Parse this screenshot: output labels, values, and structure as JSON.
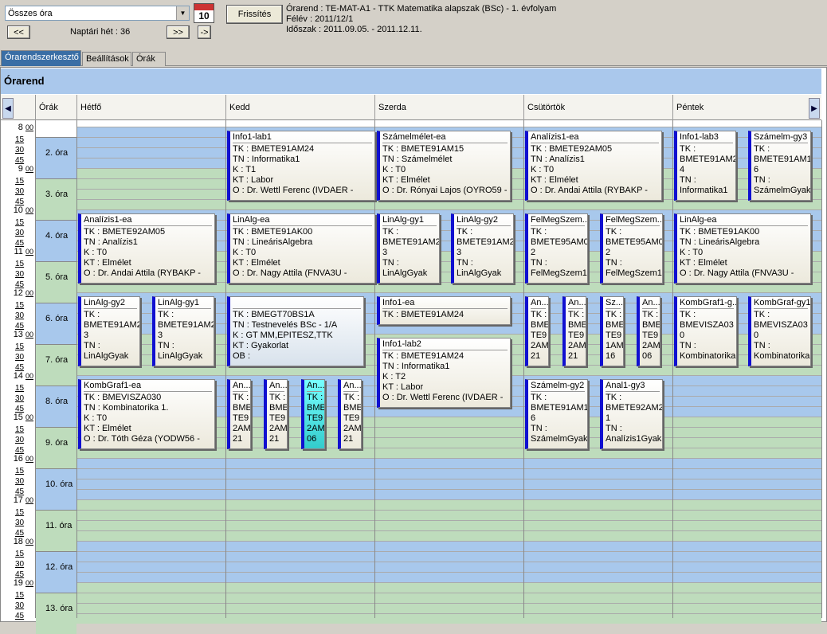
{
  "top": {
    "selector": "Összes óra",
    "calendar_num": "10",
    "refresh": "Frissítés",
    "prev": "<<",
    "next": ">>",
    "step": "->",
    "week_label": "Naptári hét : 36",
    "info": [
      "Órarend : TE-MAT-A1 - TTK Matematika alapszak (BSc) - 1. évfolyam",
      "Félév : 2011/12/1",
      "Időszak : 2011.09.05. - 2011.12.11."
    ]
  },
  "tabs": [
    "Órarendszerkesztő",
    "Beállítások",
    "Órák"
  ],
  "title": "Órarend",
  "columns": [
    "Órák",
    "Hétfő",
    "Kedd",
    "Szerda",
    "Csütörtök",
    "Péntek"
  ],
  "hours": [
    "8 00",
    "9 00",
    "10 00",
    "11 00",
    "12 00",
    "13 00",
    "14 00",
    "15 00",
    "16 00",
    "17 00",
    "18 00",
    "19 00"
  ],
  "quarters": [
    "15",
    "30",
    "45"
  ],
  "periods": [
    "2. óra",
    "3. óra",
    "4. óra",
    "5. óra",
    "6. óra",
    "7. óra",
    "8. óra",
    "9. óra",
    "10. óra",
    "11. óra",
    "12. óra",
    "13. óra"
  ],
  "events": [
    {
      "lines": [
        "Info1-lab1",
        "TK : BMETE91AM24",
        "TN : Informatika1",
        "K : T1",
        "KT : Labor",
        "O : Dr. Wettl Ferenc (IVDAER -"
      ]
    },
    {
      "lines": [
        "Számelmélet-ea",
        "TK : BMETE91AM15",
        "TN : Számelmélet",
        "K : T0",
        "KT : Elmélet",
        "O : Dr. Rónyai Lajos (OYRO59 -"
      ]
    },
    {
      "lines": [
        "Analízis1-ea",
        "TK : BMETE92AM05",
        "TN : Analízis1",
        "K : T0",
        "KT : Elmélet",
        "O : Dr. Andai Attila (RYBAKP -"
      ]
    },
    {
      "lines": [
        "Info1-lab3",
        "TK :",
        "BMETE91AM2",
        "4",
        "TN :",
        "Informatika1"
      ]
    },
    {
      "lines": [
        "Számelm-gy3",
        "TK :",
        "BMETE91AM1",
        "6",
        "TN :",
        "SzámelmGyak"
      ]
    },
    {
      "lines": [
        "Analízis1-ea",
        "TK : BMETE92AM05",
        "TN : Analízis1",
        "K : T0",
        "KT : Elmélet",
        "O : Dr. Andai Attila (RYBAKP -"
      ]
    },
    {
      "lines": [
        "LinAlg-ea",
        "TK : BMETE91AK00",
        "TN : LineárisAlgebra",
        "K : T0",
        "KT : Elmélet",
        "O : Dr. Nagy Attila (FNVA3U -"
      ]
    },
    {
      "lines": [
        "LinAlg-gy1",
        "TK :",
        "BMETE91AM2",
        "3",
        "TN :",
        "LinAlgGyak"
      ]
    },
    {
      "lines": [
        "LinAlg-gy2",
        "TK :",
        "BMETE91AM2",
        "3",
        "TN :",
        "LinAlgGyak"
      ]
    },
    {
      "lines": [
        "FelMegSzem...",
        "TK :",
        "BMETE95AM0",
        "2",
        "TN :",
        "FelMegSzem1"
      ]
    },
    {
      "lines": [
        "FelMegSzem...",
        "TK :",
        "BMETE95AM0",
        "2",
        "TN :",
        "FelMegSzem1"
      ]
    },
    {
      "lines": [
        "LinAlg-ea",
        "TK : BMETE91AK00",
        "TN : LineárisAlgebra",
        "K : T0",
        "KT : Elmélet",
        "O : Dr. Nagy Attila (FNVA3U -"
      ]
    },
    {
      "lines": [
        "LinAlg-gy2",
        "TK :",
        "BMETE91AM2",
        "3",
        "TN :",
        "LinAlgGyak"
      ]
    },
    {
      "lines": [
        "LinAlg-gy1",
        "TK :",
        "BMETE91AM2",
        "3",
        "TN :",
        "LinAlgGyak"
      ]
    },
    {
      "lines": [
        "",
        "TK : BMEGT70BS1A",
        "TN : Testnevelés BSc - 1/A",
        "K : GT MM,EPITESZ,TTK",
        "KT : Gyakorlat",
        "OB :"
      ]
    },
    {
      "lines": [
        "Info1-ea",
        "TK : BMETE91AM24"
      ]
    },
    {
      "lines": [
        "Info1-lab2",
        "TK : BMETE91AM24",
        "TN : Informatika1",
        "K : T2",
        "KT : Labor",
        "O : Dr. Wettl Ferenc (IVDAER -"
      ]
    },
    {
      "lines": [
        "An...",
        "TK :",
        "BME",
        "TE9",
        "2AM",
        "21"
      ]
    },
    {
      "lines": [
        "An...",
        "TK :",
        "BME",
        "TE9",
        "2AM",
        "21"
      ]
    },
    {
      "lines": [
        "Sz...",
        "TK :",
        "BME",
        "TE9",
        "1AM",
        "16"
      ]
    },
    {
      "lines": [
        "An...",
        "TK :",
        "BME",
        "TE9",
        "2AM",
        "06"
      ]
    },
    {
      "lines": [
        "KombGraf1-g...",
        "TK :",
        "BMEVISZA03",
        "0",
        "TN :",
        "Kombinatorika"
      ]
    },
    {
      "lines": [
        "KombGraf-gy1",
        "TK :",
        "BMEVISZA03",
        "0",
        "TN :",
        "Kombinatorika"
      ]
    },
    {
      "lines": [
        "KombGraf1-ea",
        "TK : BMEVISZA030",
        "TN : Kombinatorika 1.",
        "K : T0",
        "KT : Elmélet",
        "O : Dr. Tóth Géza (YODW56 -"
      ]
    },
    {
      "lines": [
        "An...",
        "TK :",
        "BME",
        "TE9",
        "2AM",
        "21"
      ]
    },
    {
      "lines": [
        "An...",
        "TK :",
        "BME",
        "TE9",
        "2AM",
        "21"
      ]
    },
    {
      "lines": [
        "An...",
        "TK :",
        "BME",
        "TE9",
        "2AM",
        "06"
      ]
    },
    {
      "lines": [
        "An...",
        "TK :",
        "BME",
        "TE9",
        "2AM",
        "21"
      ]
    },
    {
      "lines": [
        "Számelm-gy2",
        "TK :",
        "BMETE91AM1",
        "6",
        "TN :",
        "SzámelmGyak"
      ]
    },
    {
      "lines": [
        "Anal1-gy3",
        "TK :",
        "BMETE92AM2",
        "1",
        "TN :",
        "Analízis1Gyak"
      ]
    }
  ]
}
